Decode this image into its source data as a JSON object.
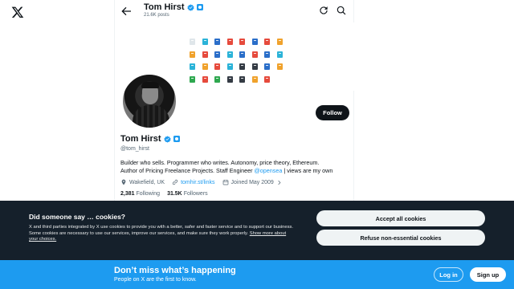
{
  "header": {
    "name": "Tom Hirst",
    "posts": "21.6K posts"
  },
  "profile": {
    "name": "Tom Hirst",
    "handle": "@tom_hirst",
    "bio_line1": "Builder who sells. Programmer who writes. Autonomy, price theory, Ethereum.",
    "bio_line2_a": "Author of Pricing Freelance Projects. Staff Engineer ",
    "bio_line2_link": "@opensea",
    "bio_line2_b": " | views are my own",
    "location": "Wakefield, UK",
    "website": "tomhir.st/links",
    "joined": "Joined May 2009",
    "following_count": "2,381",
    "following_label": "Following",
    "followers_count": "31.5K",
    "followers_label": "Followers",
    "follow_label": "Follow"
  },
  "banner": {
    "tile_colors": [
      "#dfe6ea",
      "#2bb3d8",
      "#2a6ec9",
      "#e64a3c",
      "#e64a3c",
      "#2a6ec9",
      "#e64a3c",
      "#f0a22c",
      "#f0a22c",
      "#e64a3c",
      "#2a6ec9",
      "#2bb3d8",
      "#2a6ec9",
      "#e64a3c",
      "#2a6ec9",
      "#2bb3d8",
      "#2bb3d8",
      "#f0a22c",
      "#e64a3c",
      "#2bb3d8",
      "#343b44",
      "#343b44",
      "#2a6ec9",
      "#f0a22c",
      "#2ea84f",
      "#e64a3c",
      "#2ea84f",
      "#343b44",
      "#343b44",
      "#f0a22c",
      "#e64a3c"
    ]
  },
  "cookie": {
    "title": "Did someone say … cookies?",
    "text": "X and third parties integrated by X use cookies to provide you with a better, safer and faster service and to support our business. Some cookies are necessary to use our services, improve our services, and make sure they work properly. ",
    "link": "Show more about your choices.",
    "accept_label": "Accept all cookies",
    "refuse_label": "Refuse non-essential cookies"
  },
  "promo": {
    "title": "Don’t miss what’s happening",
    "subtitle": "People on X are the first to know.",
    "login_label": "Log in",
    "signup_label": "Sign up"
  },
  "colors": {
    "accent": "#1d9bf0",
    "cookie_bg": "#15202b",
    "text": "#0f1419",
    "muted": "#536471"
  }
}
